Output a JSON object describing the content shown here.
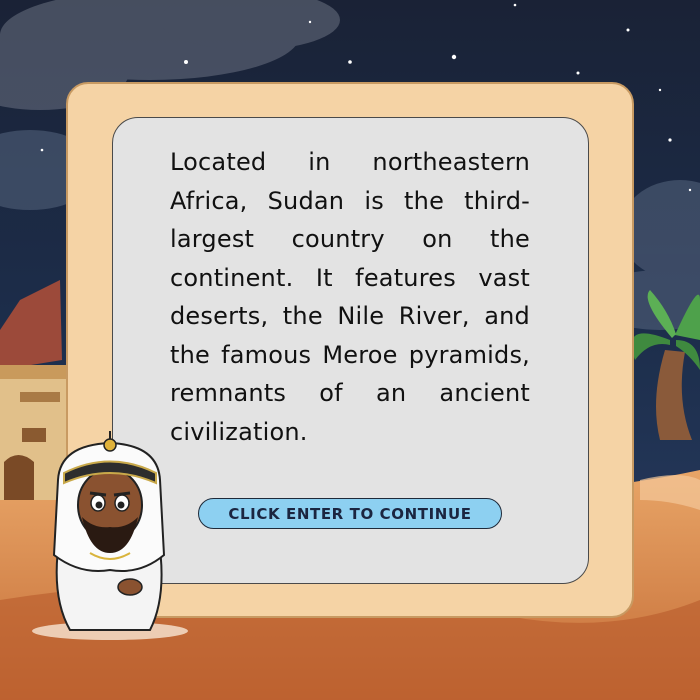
{
  "dialog": {
    "message": "Located in northeastern Africa, Sudan is the third-largest country on the continent. It features vast deserts, the Nile River, and the famous Meroe pyramids, remnants of an ancient civilization.",
    "continue_label": "CLICK ENTER TO CONTINUE"
  },
  "colors": {
    "sky": "#17253d",
    "outer_panel": "#f5d3a5",
    "inner_panel": "#e3e3e3",
    "button": "#8dd0f1",
    "sand": "#d98a4a"
  },
  "icons": {
    "character": "sudanese-man-character",
    "palm": "palm-tree-icon",
    "building": "adobe-house-icon"
  }
}
